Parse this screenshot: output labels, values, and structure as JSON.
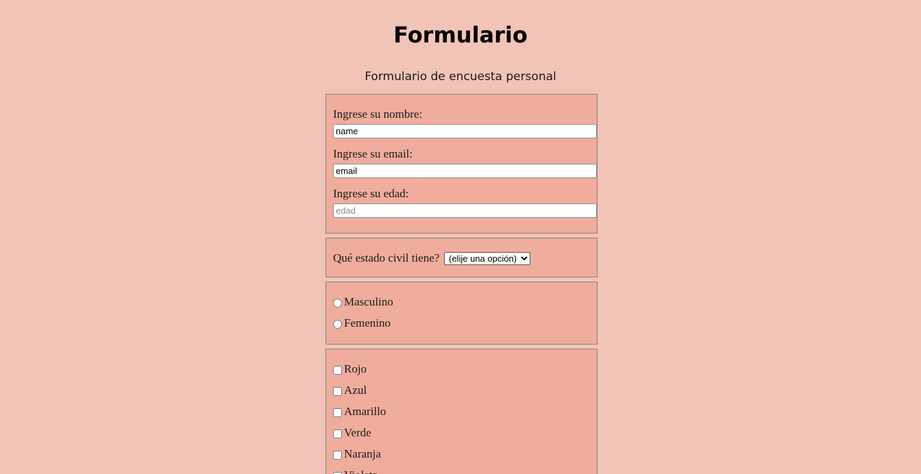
{
  "header": {
    "title": "Formulario",
    "subtitle": "Formulario de encuesta personal"
  },
  "personal": {
    "name_label": "Ingrese su nombre:",
    "name_value": "name",
    "email_label": "Ingrese su email:",
    "email_value": "email",
    "age_label": "Ingrese su edad:",
    "age_placeholder": "edad"
  },
  "civil": {
    "label": "Qué estado civil tiene?",
    "selected": "(elije una opción)"
  },
  "gender": {
    "options": [
      {
        "label": "Masculino",
        "checked": false
      },
      {
        "label": "Femenino",
        "checked": false
      }
    ]
  },
  "colors": {
    "options": [
      {
        "label": "Rojo",
        "checked": false
      },
      {
        "label": "Azul",
        "checked": false
      },
      {
        "label": "Amarillo",
        "checked": false
      },
      {
        "label": "Verde",
        "checked": false
      },
      {
        "label": "Naranja",
        "checked": false
      },
      {
        "label": "Violeta",
        "checked": false
      }
    ]
  },
  "theme": {
    "page_background": "#f2c4b8",
    "fieldset_background": "#f0ad9d",
    "fieldset_border": "#8a8080"
  }
}
